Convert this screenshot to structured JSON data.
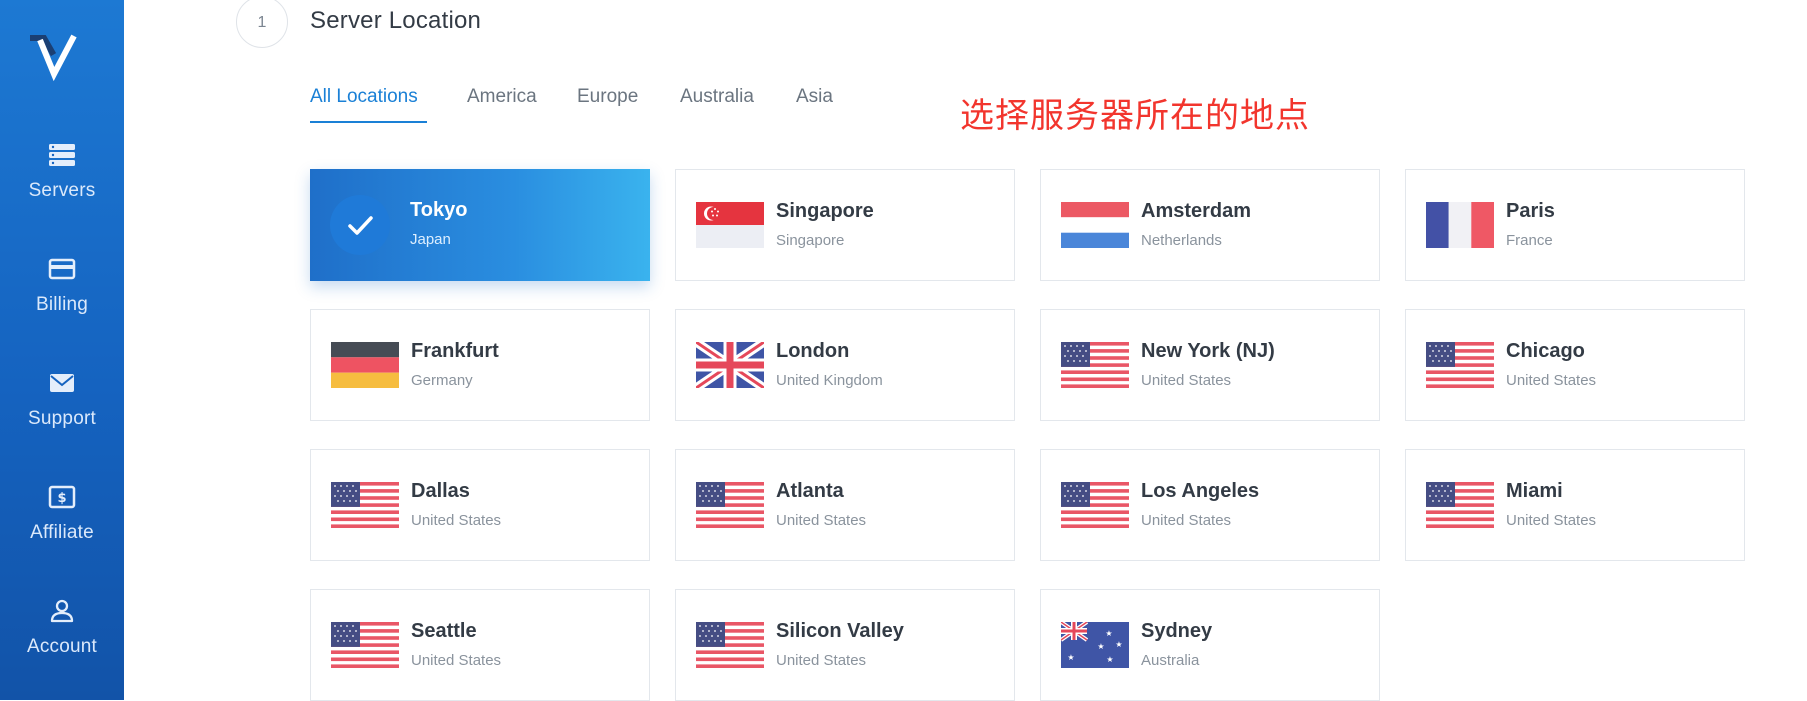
{
  "sidebar": {
    "logo_icon": "vultr-v-logo",
    "items": [
      {
        "label": "Servers",
        "icon": "servers-icon"
      },
      {
        "label": "Billing",
        "icon": "credit-card-icon"
      },
      {
        "label": "Support",
        "icon": "envelope-icon"
      },
      {
        "label": "Affiliate",
        "icon": "dollar-bill-icon"
      },
      {
        "label": "Account",
        "icon": "user-icon"
      }
    ]
  },
  "header": {
    "step_number": "1",
    "title": "Server Location"
  },
  "tabs": [
    {
      "label": "All Locations",
      "active": true
    },
    {
      "label": "America",
      "active": false
    },
    {
      "label": "Europe",
      "active": false
    },
    {
      "label": "Australia",
      "active": false
    },
    {
      "label": "Asia",
      "active": false
    }
  ],
  "annotation": "选择服务器所在的地点",
  "colors": {
    "accent": "#1a80d6",
    "sidebar": "#1563c0",
    "annotation": "#f2352d"
  },
  "locations": [
    {
      "city": "Tokyo",
      "country": "Japan",
      "flag": "check-icon",
      "selected": true
    },
    {
      "city": "Singapore",
      "country": "Singapore",
      "flag": "singapore-flag",
      "selected": false
    },
    {
      "city": "Amsterdam",
      "country": "Netherlands",
      "flag": "netherlands-flag",
      "selected": false
    },
    {
      "city": "Paris",
      "country": "France",
      "flag": "france-flag",
      "selected": false
    },
    {
      "city": "Frankfurt",
      "country": "Germany",
      "flag": "germany-flag",
      "selected": false
    },
    {
      "city": "London",
      "country": "United Kingdom",
      "flag": "uk-flag",
      "selected": false
    },
    {
      "city": "New York (NJ)",
      "country": "United States",
      "flag": "us-flag",
      "selected": false
    },
    {
      "city": "Chicago",
      "country": "United States",
      "flag": "us-flag",
      "selected": false
    },
    {
      "city": "Dallas",
      "country": "United States",
      "flag": "us-flag",
      "selected": false
    },
    {
      "city": "Atlanta",
      "country": "United States",
      "flag": "us-flag",
      "selected": false
    },
    {
      "city": "Los Angeles",
      "country": "United States",
      "flag": "us-flag",
      "selected": false
    },
    {
      "city": "Miami",
      "country": "United States",
      "flag": "us-flag",
      "selected": false
    },
    {
      "city": "Seattle",
      "country": "United States",
      "flag": "us-flag",
      "selected": false
    },
    {
      "city": "Silicon Valley",
      "country": "United States",
      "flag": "us-flag",
      "selected": false
    },
    {
      "city": "Sydney",
      "country": "Australia",
      "flag": "australia-flag",
      "selected": false
    }
  ]
}
